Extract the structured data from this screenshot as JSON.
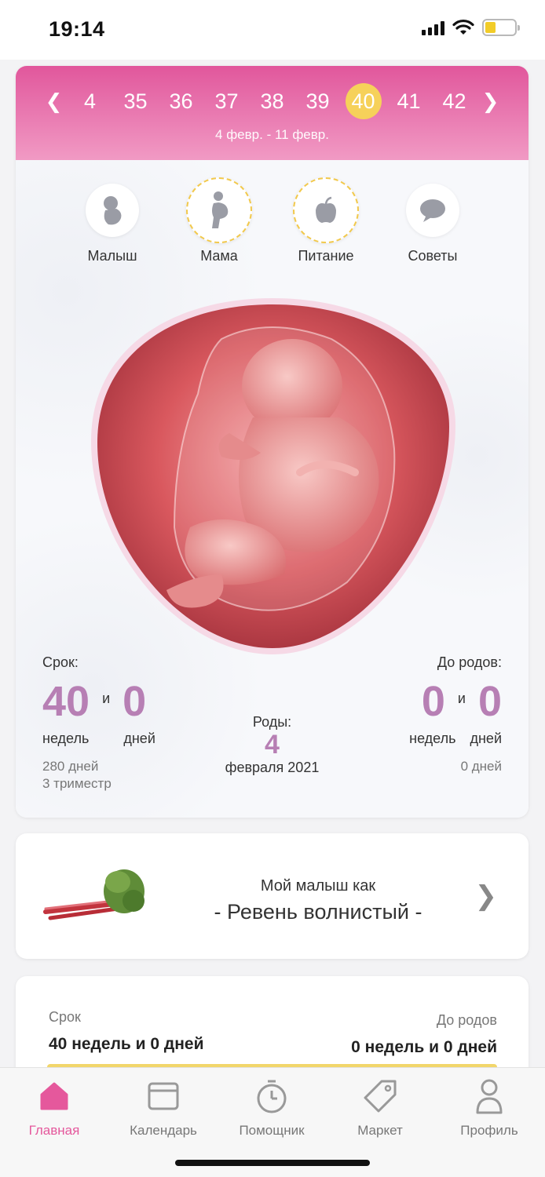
{
  "status_bar": {
    "time": "19:14"
  },
  "weeks": {
    "items": [
      "4",
      "35",
      "36",
      "37",
      "38",
      "39",
      "40",
      "41",
      "42"
    ],
    "active": "40",
    "range": "4 февр. - 11 февр."
  },
  "tabs": [
    {
      "label": "Малыш",
      "icon": "baby-icon"
    },
    {
      "label": "Мама",
      "icon": "pregnant-woman-icon"
    },
    {
      "label": "Питание",
      "icon": "apple-icon"
    },
    {
      "label": "Советы",
      "icon": "speech-bubble-icon"
    }
  ],
  "stats": {
    "term_label": "Срок:",
    "weeks_value": "40",
    "and": "и",
    "days_value": "0",
    "weeks_unit": "недель",
    "days_unit": "дней",
    "total_days": "280 дней",
    "trimester": "3 триместр",
    "birth_label": "Роды:",
    "birth_day": "4",
    "birth_month": "февраля 2021",
    "until_label": "До родов:",
    "until_weeks": "0",
    "until_days": "0",
    "until_weeks_unit": "недель",
    "until_days_unit": "дней",
    "until_total": "0 дней"
  },
  "fruit": {
    "line1": "Мой малыш как",
    "line2": "- Ревень волнистый -"
  },
  "term_card": {
    "term_label": "Срок",
    "term_value": "40 недель и 0 дней",
    "until_label": "До родов",
    "until_value": "0 недель и 0 дней",
    "progress": 1.0
  },
  "nav": [
    {
      "label": "Главная",
      "icon": "home-icon",
      "active": true
    },
    {
      "label": "Календарь",
      "icon": "calendar-icon",
      "active": false
    },
    {
      "label": "Помощник",
      "icon": "stopwatch-icon",
      "active": false
    },
    {
      "label": "Маркет",
      "icon": "tag-icon",
      "active": false
    },
    {
      "label": "Профиль",
      "icon": "profile-icon",
      "active": false
    }
  ],
  "colors": {
    "accent": "#e5589c",
    "highlight": "#f6d15a",
    "stat": "#b77fb4"
  }
}
